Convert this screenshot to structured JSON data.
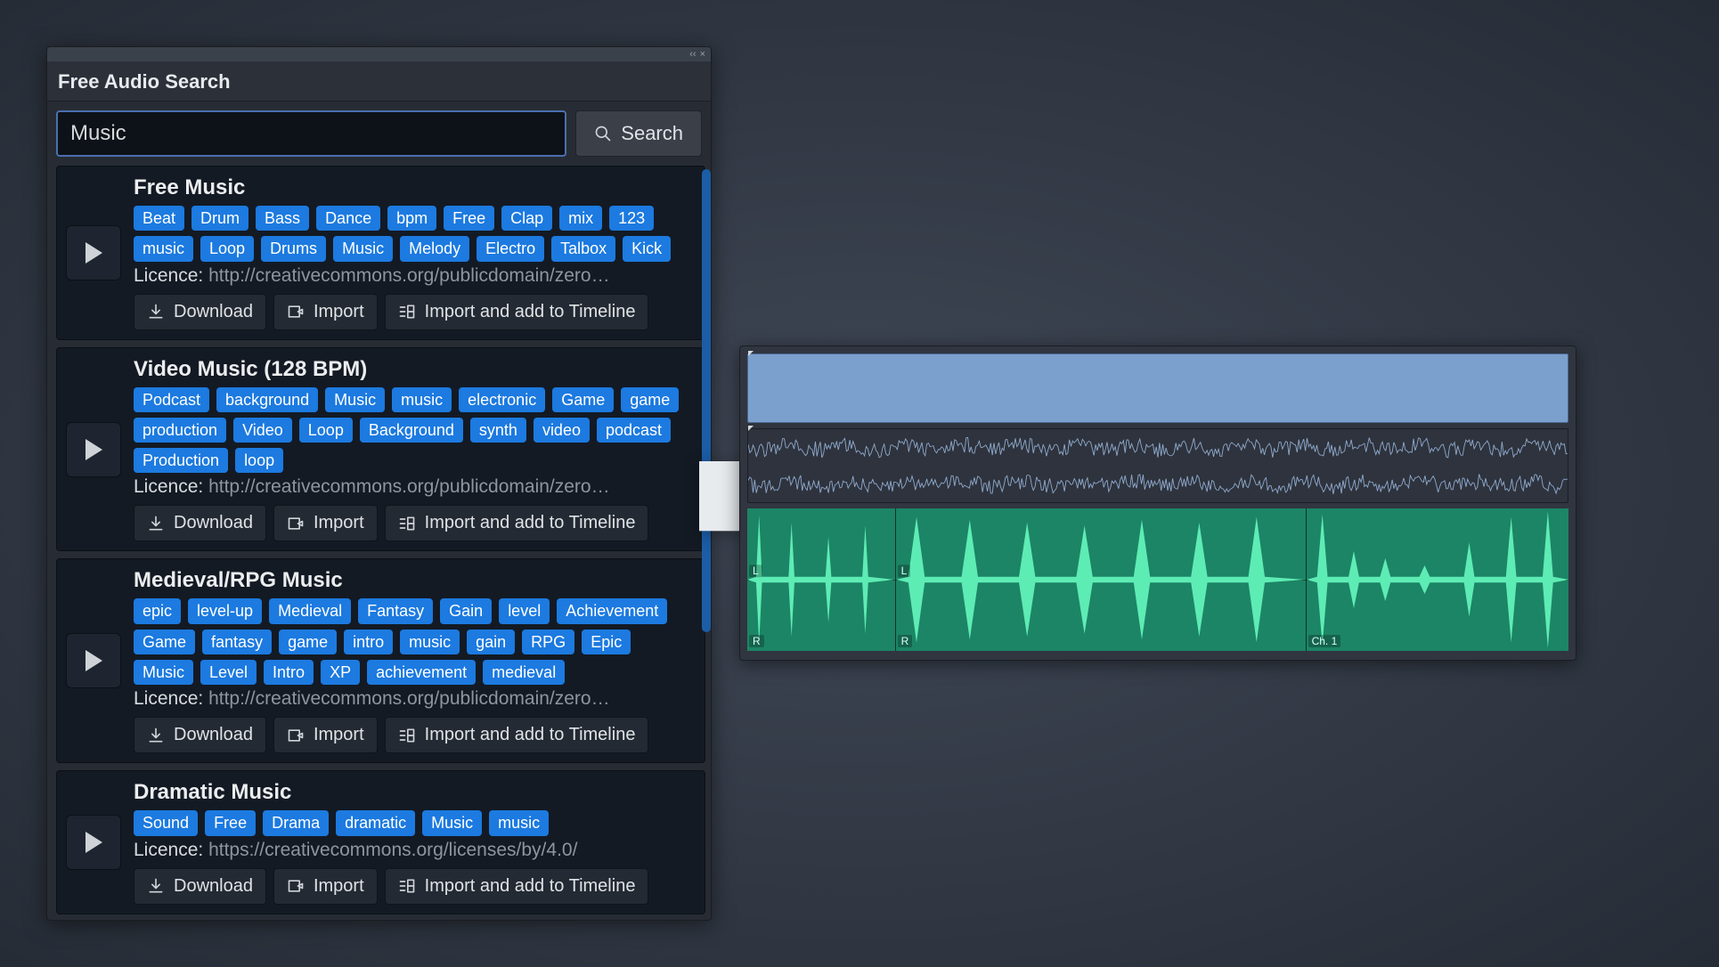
{
  "panel": {
    "title": "Free Audio Search",
    "window_buttons": {
      "collapse": "‹‹",
      "close": "×"
    }
  },
  "search": {
    "value": "Music",
    "button_label": "Search"
  },
  "licence_word": "Licence:",
  "buttons": {
    "download": "Download",
    "import": "Import",
    "import_timeline": "Import and add to Timeline"
  },
  "results": [
    {
      "title": "Free Music",
      "tags": [
        "Beat",
        "Drum",
        "Bass",
        "Dance",
        "bpm",
        "Free",
        "Clap",
        "mix",
        "123",
        "music",
        "Loop",
        "Drums",
        "Music",
        "Melody",
        "Electro",
        "Talbox",
        "Kick"
      ],
      "licence": "http://creativecommons.org/publicdomain/zero…"
    },
    {
      "title": "Video Music (128 BPM)",
      "tags": [
        "Podcast",
        "background",
        "Music",
        "music",
        "electronic",
        "Game",
        "game",
        "production",
        "Video",
        "Loop",
        "Background",
        "synth",
        "video",
        "podcast",
        "Production",
        "loop"
      ],
      "licence": "http://creativecommons.org/publicdomain/zero…"
    },
    {
      "title": "Medieval/RPG Music",
      "tags": [
        "epic",
        "level-up",
        "Medieval",
        "Fantasy",
        "Gain",
        "level",
        "Achievement",
        "Game",
        "fantasy",
        "game",
        "intro",
        "music",
        "gain",
        "RPG",
        "Epic",
        "Music",
        "Level",
        "Intro",
        "XP",
        "achievement",
        "medieval"
      ],
      "licence": "http://creativecommons.org/publicdomain/zero…"
    },
    {
      "title": "Dramatic Music",
      "tags": [
        "Sound",
        "Free",
        "Drama",
        "dramatic",
        "Music",
        "music"
      ],
      "licence": "https://creativecommons.org/licenses/by/4.0/"
    }
  ],
  "timeline": {
    "channel_L": "L",
    "channel_R": "R",
    "channel_1": "Ch. 1"
  }
}
